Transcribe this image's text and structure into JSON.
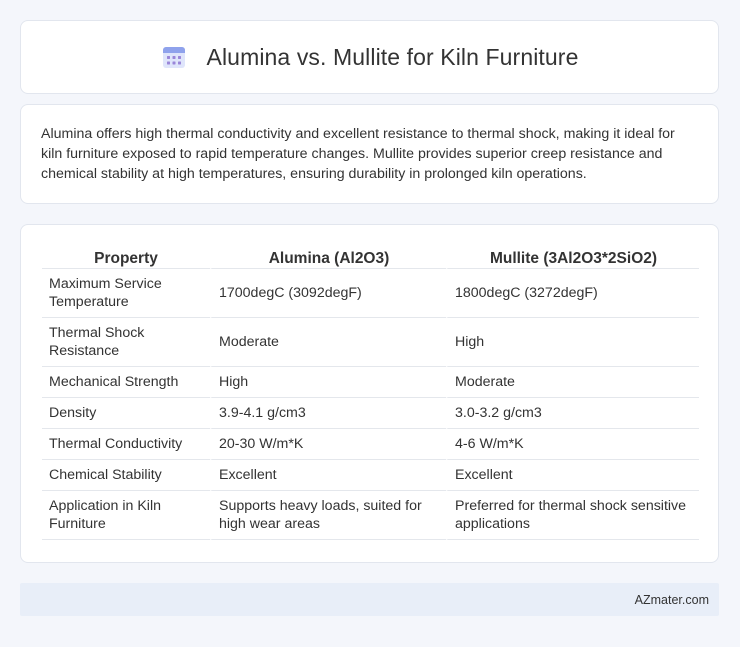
{
  "header": {
    "title": "Alumina vs. Mullite for Kiln Furniture",
    "icon": "calendar-grid-icon"
  },
  "summary": {
    "text": "Alumina offers high thermal conductivity and excellent resistance to thermal shock, making it ideal for kiln furniture exposed to rapid temperature changes. Mullite provides superior creep resistance and chemical stability at high temperatures, ensuring durability in prolonged kiln operations."
  },
  "table": {
    "headers": [
      "Property",
      "Alumina (Al2O3)",
      "Mullite (3Al2O3*2SiO2)"
    ],
    "rows": [
      [
        "Maximum Service Temperature",
        "1700degC (3092degF)",
        "1800degC (3272degF)"
      ],
      [
        "Thermal Shock Resistance",
        "Moderate",
        "High"
      ],
      [
        "Mechanical Strength",
        "High",
        "Moderate"
      ],
      [
        "Density",
        "3.9-4.1 g/cm3",
        "3.0-3.2 g/cm3"
      ],
      [
        "Thermal Conductivity",
        "20-30 W/m*K",
        "4-6 W/m*K"
      ],
      [
        "Chemical Stability",
        "Excellent",
        "Excellent"
      ],
      [
        "Application in Kiln Furniture",
        "Supports heavy loads, suited for high wear areas",
        "Preferred for thermal shock sensitive applications"
      ]
    ]
  },
  "footer": {
    "site": "AZmater.com"
  },
  "colors": {
    "page_background": "#f4f6fb",
    "card_background": "#ffffff",
    "footer_background": "#e8eef8",
    "icon_accent": "#7b8fe0"
  }
}
